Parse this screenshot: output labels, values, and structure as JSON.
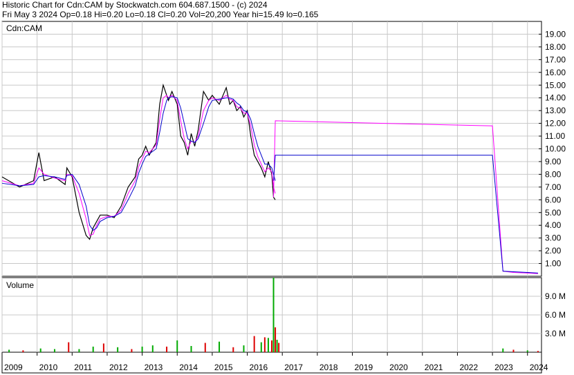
{
  "header": {
    "line1": "Historic Chart for Cdn:CAM by Stockwatch.com 604.687.1500 - (c) 2024",
    "line2": "Fri May  3 2024   Op=0.18  Hi=0.20  Lo=0.18  Cl=0.20  Vol=20,200  Year hi=15.49  lo=0.165"
  },
  "colors": {
    "price": "#000000",
    "fast_ma": "#ff00ff",
    "slow_ma": "#0000cc",
    "vol_up": "#00aa00",
    "vol_down": "#dd0000",
    "grid": "#c8c8c8"
  },
  "chart_data": [
    {
      "type": "line",
      "title": "Cdn:CAM",
      "ylim": [
        0,
        20
      ],
      "yticks": [
        "1.00",
        "2.00",
        "3.00",
        "4.00",
        "5.00",
        "6.00",
        "7.00",
        "8.00",
        "9.00",
        "10.00",
        "11.00",
        "12.00",
        "13.00",
        "14.00",
        "15.00",
        "16.00",
        "17.00",
        "18.00",
        "19.00"
      ],
      "x_ticks": [
        "2009",
        "2010",
        "2011",
        "2012",
        "2013",
        "2014",
        "2015",
        "2016",
        "2017",
        "2018",
        "2019",
        "2020",
        "2021",
        "2022",
        "2023",
        "2024"
      ],
      "x": [
        2009.0,
        2009.5,
        2009.9,
        2010.05,
        2010.2,
        2010.5,
        2010.8,
        2010.85,
        2011.0,
        2011.2,
        2011.4,
        2011.5,
        2011.6,
        2011.7,
        2011.8,
        2012.0,
        2012.2,
        2012.4,
        2012.6,
        2012.8,
        2012.9,
        2013.0,
        2013.1,
        2013.2,
        2013.4,
        2013.5,
        2013.6,
        2013.7,
        2013.75,
        2013.85,
        2014.0,
        2014.1,
        2014.2,
        2014.3,
        2014.4,
        2014.5,
        2014.6,
        2014.75,
        2014.9,
        2015.0,
        2015.2,
        2015.4,
        2015.5,
        2015.6,
        2015.7,
        2015.8,
        2015.9,
        2016.0,
        2016.1,
        2016.2,
        2016.3,
        2016.4,
        2016.5,
        2016.6,
        2016.7,
        2016.75,
        2016.8
      ],
      "series": [
        {
          "values": [
            7.8,
            7.0,
            7.5,
            9.7,
            7.5,
            7.8,
            7.2,
            8.5,
            7.8,
            5.0,
            3.2,
            2.9,
            3.8,
            4.3,
            4.8,
            4.8,
            4.6,
            5.5,
            7.0,
            7.8,
            9.2,
            9.5,
            10.2,
            9.5,
            10.5,
            13.5,
            15.0,
            14.2,
            13.8,
            14.5,
            13.5,
            11.0,
            10.5,
            9.5,
            11.2,
            10.2,
            11.5,
            14.5,
            13.8,
            14.2,
            13.5,
            14.8,
            13.5,
            13.8,
            13.0,
            13.3,
            12.5,
            13.0,
            11.0,
            9.5,
            9.0,
            8.5,
            7.8,
            9.0,
            8.0,
            6.2,
            6.0
          ]
        },
        {
          "values": [
            7.5,
            7.1,
            7.3,
            8.5,
            8.0,
            7.7,
            7.5,
            8.0,
            7.9,
            6.5,
            4.5,
            3.2,
            3.3,
            4.0,
            4.5,
            4.7,
            4.7,
            5.2,
            6.5,
            7.5,
            8.6,
            9.2,
            9.8,
            9.7,
            10.3,
            12.3,
            14.0,
            14.2,
            14.0,
            14.2,
            13.8,
            12.2,
            10.8,
            10.0,
            10.6,
            10.5,
            11.0,
            13.0,
            13.8,
            14.0,
            13.8,
            14.2,
            13.9,
            13.8,
            13.3,
            13.2,
            12.8,
            12.8,
            11.8,
            10.3,
            9.4,
            8.8,
            8.2,
            8.5,
            8.2,
            7.0,
            6.5
          ]
        },
        {
          "values": [
            7.3,
            7.1,
            7.2,
            7.8,
            7.9,
            7.8,
            7.6,
            7.9,
            8.0,
            7.2,
            5.5,
            4.0,
            3.6,
            3.8,
            4.3,
            4.6,
            4.7,
            5.0,
            6.0,
            7.1,
            8.1,
            8.8,
            9.4,
            9.6,
            10.0,
            11.3,
            12.8,
            13.8,
            14.0,
            14.1,
            14.0,
            13.2,
            12.0,
            10.8,
            10.6,
            10.5,
            10.8,
            12.0,
            13.3,
            13.8,
            13.9,
            14.0,
            14.0,
            13.9,
            13.6,
            13.4,
            13.0,
            12.9,
            12.3,
            11.2,
            10.2,
            9.5,
            8.8,
            8.8,
            8.5,
            8.0,
            7.5
          ]
        }
      ],
      "series_name_note": ""
    },
    {
      "type": "line",
      "title": "",
      "ylim": [
        0,
        12
      ],
      "yticks": [
        "3.0 M",
        "6.0 M",
        "9.0 M"
      ],
      "x": [
        2016.75,
        2016.8,
        2023.0,
        2023.3,
        2023.6,
        2024.0,
        2024.3
      ],
      "series": [
        {
          "values": [
            6.2,
            12.2,
            11.8,
            0.4,
            0.3,
            0.25,
            0.2
          ]
        },
        {
          "values": [
            7.5,
            9.5,
            9.5,
            0.4,
            0.35,
            0.3,
            0.25
          ]
        }
      ]
    },
    {
      "type": "bar",
      "title": "Volume",
      "ylim": [
        0,
        12
      ],
      "yticks": [
        "3.0 M",
        "6.0 M",
        "9.0 M"
      ],
      "x": [
        2009.2,
        2009.6,
        2010.1,
        2010.5,
        2010.9,
        2011.2,
        2011.6,
        2011.9,
        2012.3,
        2012.7,
        2013.0,
        2013.3,
        2013.7,
        2014.0,
        2014.4,
        2014.8,
        2015.2,
        2015.6,
        2015.9,
        2016.2,
        2016.4,
        2016.5,
        2016.6,
        2016.7,
        2016.75,
        2016.8,
        2016.85,
        2016.9,
        2023.3,
        2023.6,
        2024.0,
        2024.3
      ],
      "values": [
        0.4,
        0.3,
        0.6,
        0.5,
        1.6,
        0.5,
        0.9,
        1.4,
        0.8,
        0.5,
        0.9,
        1.1,
        0.9,
        1.9,
        1.0,
        1.5,
        1.7,
        0.8,
        1.1,
        2.6,
        1.6,
        2.4,
        2.3,
        1.9,
        12.0,
        4.0,
        2.0,
        1.5,
        0.6,
        0.4,
        0.3,
        0.2
      ],
      "up": [
        true,
        false,
        true,
        true,
        false,
        true,
        true,
        false,
        true,
        false,
        true,
        true,
        false,
        true,
        true,
        false,
        true,
        false,
        true,
        false,
        true,
        false,
        true,
        false,
        true,
        false,
        true,
        false,
        true,
        false,
        true,
        false
      ]
    }
  ]
}
